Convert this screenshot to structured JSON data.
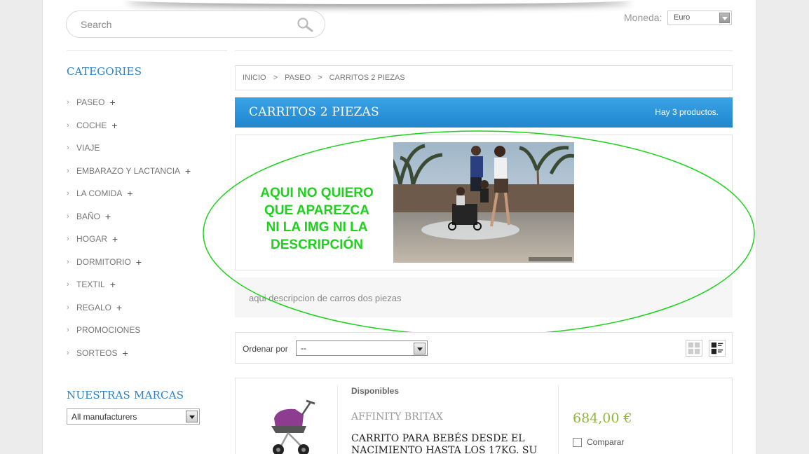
{
  "search": {
    "placeholder": "Search"
  },
  "currency": {
    "label": "Moneda:",
    "selected": "Euro"
  },
  "sidebar": {
    "categories_title": "CATEGORIES",
    "items": [
      {
        "label": "PASEO",
        "expandable": true
      },
      {
        "label": "COCHE",
        "expandable": true
      },
      {
        "label": "VIAJE",
        "expandable": false
      },
      {
        "label": "EMBARAZO Y LACTANCIA",
        "expandable": true
      },
      {
        "label": "LA COMIDA",
        "expandable": true
      },
      {
        "label": "BAÑO",
        "expandable": true
      },
      {
        "label": "HOGAR",
        "expandable": true
      },
      {
        "label": "DORMITORIO",
        "expandable": true
      },
      {
        "label": "TEXTIL",
        "expandable": true
      },
      {
        "label": "REGALO",
        "expandable": true
      },
      {
        "label": "PROMOCIONES",
        "expandable": false
      },
      {
        "label": "SORTEOS",
        "expandable": true
      }
    ],
    "brands_title": "NUESTRAS MARCAS",
    "brands_selected": "All manufacturers"
  },
  "breadcrumb": [
    "INICIO",
    "PASEO",
    "CARRITOS 2 PIEZAS"
  ],
  "category": {
    "name": "CARRITOS 2 PIEZAS",
    "count": "Hay 3 productos.",
    "description": "aqui descripcion de carros dos piezas"
  },
  "annotation": {
    "lines": [
      "AQUI NO  QUIERO",
      "QUE APAREZCA",
      "NI LA IMG NI LA",
      "DESCRIPCIÓN"
    ],
    "color": "#1dd11d"
  },
  "sort": {
    "label": "Ordenar por",
    "selected": "--"
  },
  "product": {
    "availability": "Disponibles",
    "manufacturer": "AFFINITY BRITAX",
    "name": "CARRITO PARA BEBÉS DESDE EL NACIMIENTO HASTA LOS 17KG. SU",
    "price": "684,00 €",
    "compare_label": "Comparar"
  },
  "colors": {
    "accent": "#2a83c9",
    "banner": "#2b94db",
    "price": "#8cb63c"
  }
}
